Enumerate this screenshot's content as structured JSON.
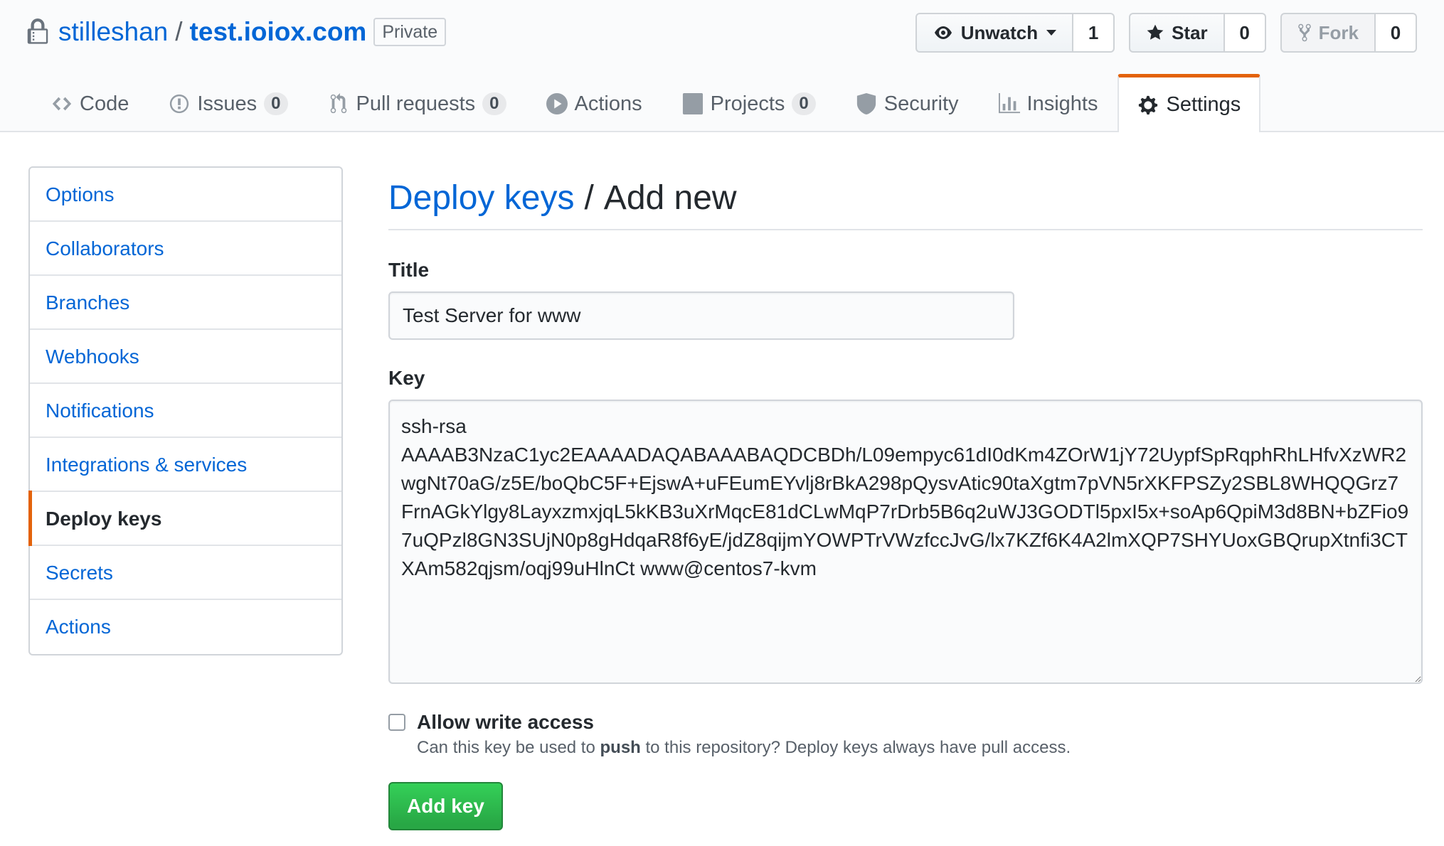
{
  "repo": {
    "owner": "stilleshan",
    "separator": "/",
    "name": "test.ioiox.com",
    "visibility": "Private"
  },
  "actions": {
    "watch": {
      "label": "Unwatch",
      "count": "1",
      "icon": "eye-icon"
    },
    "star": {
      "label": "Star",
      "count": "0",
      "icon": "star-icon"
    },
    "fork": {
      "label": "Fork",
      "count": "0",
      "icon": "fork-icon"
    }
  },
  "tabs": [
    {
      "label": "Code",
      "icon": "code-icon"
    },
    {
      "label": "Issues",
      "counter": "0",
      "icon": "issue-icon"
    },
    {
      "label": "Pull requests",
      "counter": "0",
      "icon": "pull-request-icon"
    },
    {
      "label": "Actions",
      "icon": "play-icon"
    },
    {
      "label": "Projects",
      "counter": "0",
      "icon": "project-icon"
    },
    {
      "label": "Security",
      "icon": "shield-icon"
    },
    {
      "label": "Insights",
      "icon": "graph-icon"
    },
    {
      "label": "Settings",
      "icon": "gear-icon",
      "selected": true
    }
  ],
  "sidebar": {
    "items": [
      {
        "label": "Options"
      },
      {
        "label": "Collaborators"
      },
      {
        "label": "Branches"
      },
      {
        "label": "Webhooks"
      },
      {
        "label": "Notifications"
      },
      {
        "label": "Integrations & services"
      },
      {
        "label": "Deploy keys",
        "selected": true
      },
      {
        "label": "Secrets"
      },
      {
        "label": "Actions"
      }
    ]
  },
  "main": {
    "heading_link": "Deploy keys",
    "heading_sep": "/",
    "heading_rest": "Add new",
    "title_label": "Title",
    "title_value": "Test Server for www",
    "key_label": "Key",
    "key_value": "ssh-rsa\nAAAAB3NzaC1yc2EAAAADAQABAAABAQDCBDh/L09empyc61dI0dKm4ZOrW1jY72UypfSpRqphRhLHfvXzWR2wgNt70aG/z5E/boQbC5F+EjswA+uFEumEYvlj8rBkA298pQysvAtic90taXgtm7pVN5rXKFPSZy2SBL8WHQQGrz7FrnAGkYlgy8LayxzmxjqL5kKB3uXrMqcE81dCLwMqP7rDrb5B6q2uWJ3GODTl5pxI5x+soAp6QpiM3d8BN+bZFio97uQPzl8GN3SUjN0p8gHdqaR8f6yE/jdZ8qijmYOWPTrVWzfccJvG/lx7KZf6K4A2lmXQP7SHYUoxGBQrupXtnfi3CTXAm582qjsm/oqj99uHlnCt www@centos7-kvm",
    "write_access_label": "Allow write access",
    "note_prefix": "Can this key be used to",
    "note_bold": "push",
    "note_suffix": "to this repository? Deploy keys always have pull access.",
    "submit_label": "Add key"
  },
  "colors": {
    "link": "#0366d6",
    "accent": "#e36209",
    "primary_button": "#28a745"
  }
}
